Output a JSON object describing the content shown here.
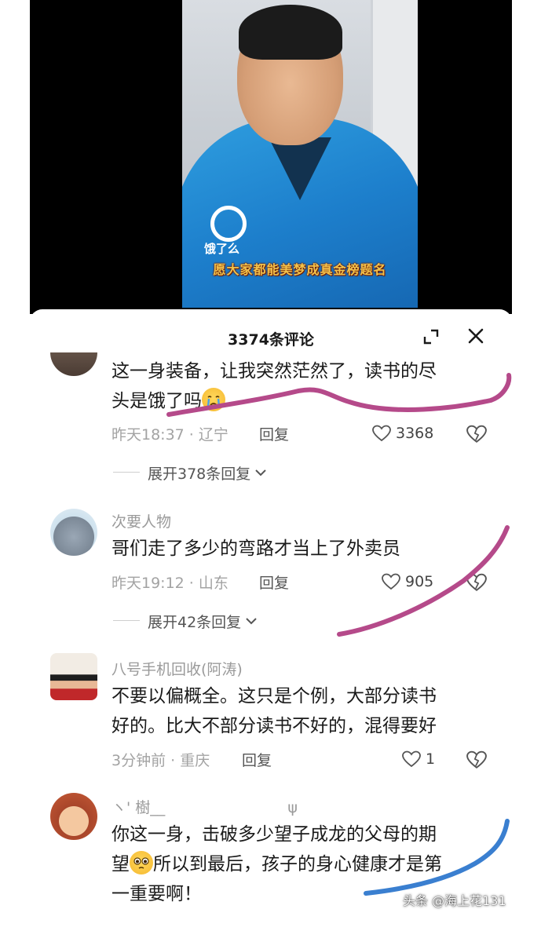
{
  "video": {
    "caption": "愿大家都能美梦成真金榜题名",
    "jacket_brand": "饿了么"
  },
  "sheet": {
    "title": "3374条评论"
  },
  "comments": [
    {
      "username": "",
      "text_line1": "这一身装备，让我突然茫然了，读书的尽",
      "text_line2": "头是饿了吗",
      "time": "昨天18:37 · 辽宁",
      "reply": "回复",
      "likes": "3368",
      "expand": "展开378条回复"
    },
    {
      "username": "次要人物",
      "text_line1": "哥们走了多少的弯路才当上了外卖员",
      "time": "昨天19:12 · 山东",
      "reply": "回复",
      "likes": "905",
      "expand": "展开42条回复"
    },
    {
      "username": "八号手机回收(阿涛)",
      "text_line1": "不要以偏概全。这只是个例，大部分读书",
      "text_line2": "好的。比大不部分读书不好的，混得要好",
      "time": "3分钟前 · 重庆",
      "reply": "回复",
      "likes": "1"
    },
    {
      "username": "ヽ' 樹__",
      "username_extra": "ψ",
      "text_line1": "你这一身，击破多少望子成龙的父母的期",
      "text_line2_after_emoji": "所以到最后，孩子的身心健康才是第",
      "text_line2_before_emoji": "望",
      "text_line3": "一重要啊！"
    }
  ],
  "watermark": "头条 @海上花131",
  "colors": {
    "scribble_pink": "#b54a8a",
    "scribble_blue": "#3a7fd0",
    "jacket_blue": "#1d7fcc"
  },
  "icons": [
    "expand-icon",
    "close-icon",
    "heart-icon",
    "broken-heart-icon",
    "chevron-down-icon",
    "crying-emoji",
    "pleading-emoji"
  ]
}
